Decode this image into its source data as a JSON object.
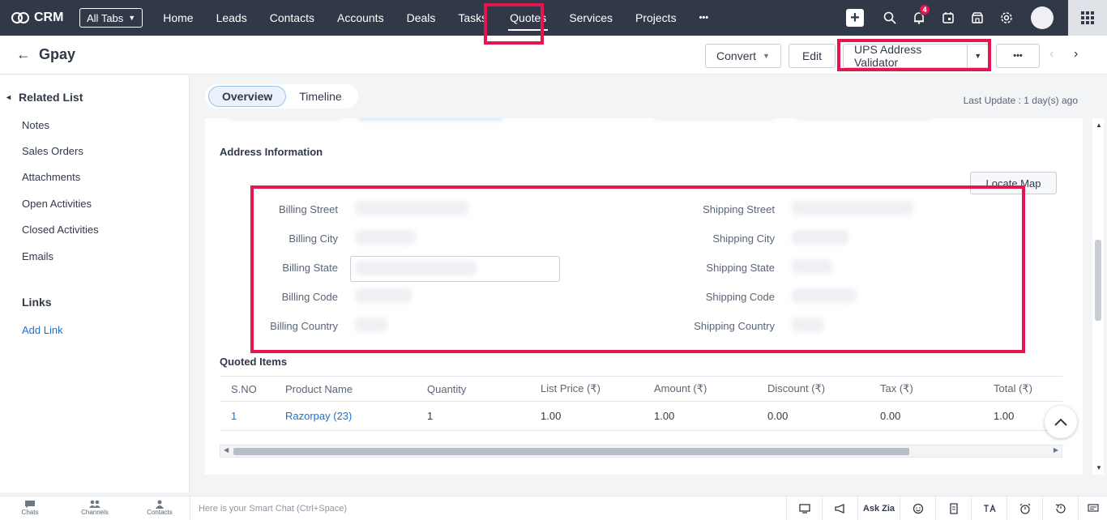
{
  "topnav": {
    "brand": "CRM",
    "all_tabs": "All Tabs",
    "tabs": [
      "Home",
      "Leads",
      "Contacts",
      "Accounts",
      "Deals",
      "Tasks",
      "Quotes",
      "Services",
      "Projects"
    ],
    "more": "•••",
    "notification_count": "4"
  },
  "record": {
    "title": "Gpay",
    "convert": "Convert",
    "edit": "Edit",
    "ups": "UPS Address Validator",
    "more": "•••"
  },
  "sidebar": {
    "related_list": "Related List",
    "items": [
      "Notes",
      "Sales Orders",
      "Attachments",
      "Open Activities",
      "Closed Activities",
      "Emails"
    ],
    "links_title": "Links",
    "add_link": "Add Link"
  },
  "tabs": {
    "overview": "Overview",
    "timeline": "Timeline"
  },
  "last_update": "Last Update : 1 day(s) ago",
  "address": {
    "title": "Address Information",
    "locate_map": "Locate Map",
    "billing_labels": [
      "Billing Street",
      "Billing City",
      "Billing State",
      "Billing Code",
      "Billing Country"
    ],
    "shipping_labels": [
      "Shipping Street",
      "Shipping City",
      "Shipping State",
      "Shipping Code",
      "Shipping Country"
    ]
  },
  "quoted_items": {
    "title": "Quoted Items",
    "headers": [
      "S.NO",
      "Product Name",
      "Quantity",
      "List Price (₹)",
      "Amount (₹)",
      "Discount (₹)",
      "Tax (₹)",
      "Total (₹)"
    ],
    "rows": [
      [
        "1",
        "Razorpay (23)",
        "1",
        "1.00",
        "1.00",
        "0.00",
        "0.00",
        "1.00"
      ]
    ]
  },
  "bottombar": {
    "chats": "Chats",
    "channels": "Channels",
    "contacts": "Contacts",
    "smart_chat_placeholder": "Here is your Smart Chat (Ctrl+Space)",
    "ask_zia": "Ask Zia"
  },
  "colors": {
    "nav_bg": "#313949",
    "highlight": "#e5164f",
    "link": "#1a74ce"
  }
}
